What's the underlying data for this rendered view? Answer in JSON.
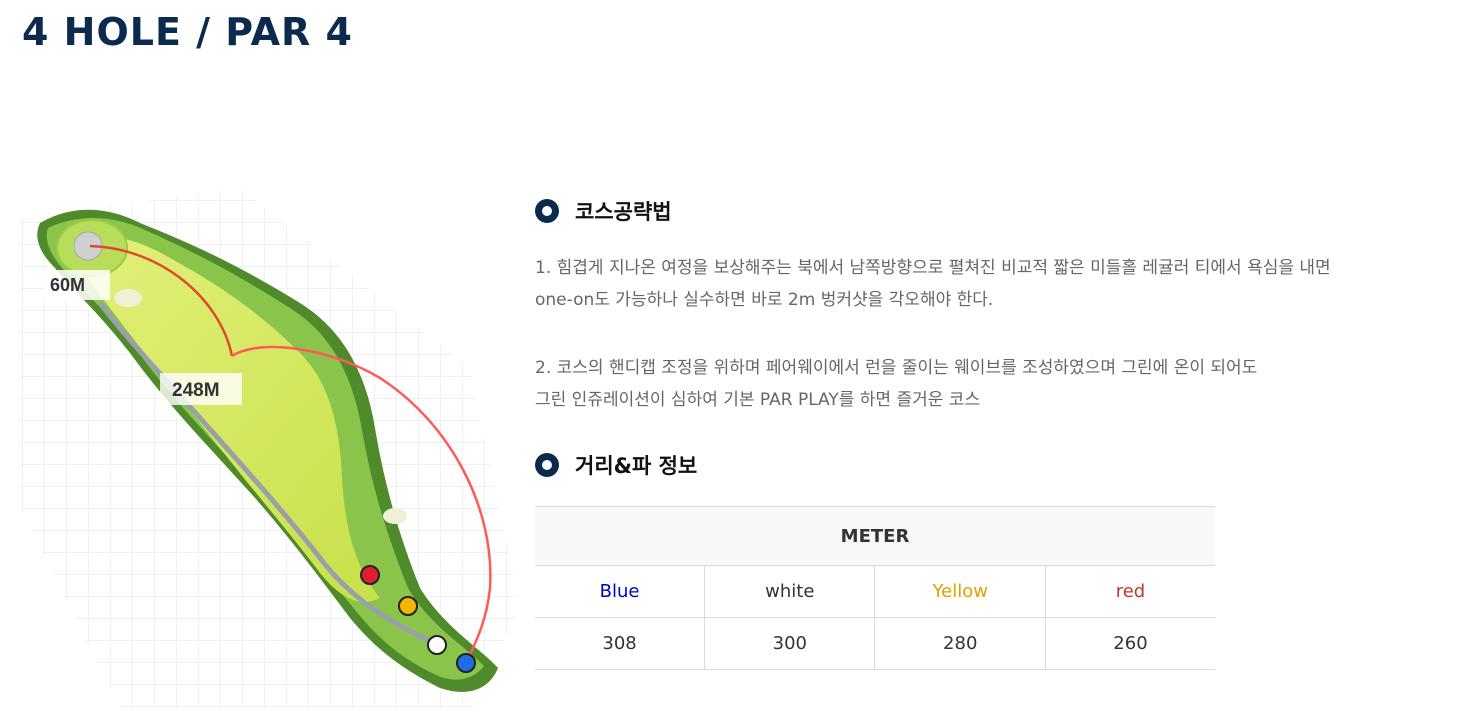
{
  "header": {
    "title": "4 HOLE / PAR 4"
  },
  "course_map": {
    "labels": {
      "green_distance": "60M",
      "fairway_distance": "248M"
    },
    "tee_markers": [
      {
        "name": "red",
        "color": "#e01e2e"
      },
      {
        "name": "yellow",
        "color": "#f2b500"
      },
      {
        "name": "white",
        "color": "#ffffff"
      },
      {
        "name": "blue",
        "color": "#1e6ee0"
      }
    ]
  },
  "strategy": {
    "heading": "코스공략법",
    "paragraphs": [
      {
        "line1": "1. 힘겹게 지나온 여정을 보상해주는 북에서 남쪽방향으로 펼쳐진 비교적 짧은 미들홀 레귤러 티에서 욕심을 내면",
        "line2": "one-on도 가능하나 실수하면 바로 2m 벙커샷을 각오해야 한다."
      },
      {
        "line1": "2. 코스의 핸디캡 조정을 위하며 페어웨이에서 런을 줄이는 웨이브를 조성하였으며 그린에 온이 되어도",
        "line2": "그린 인쥬레이션이 심하여 기본 PAR PLAY를 하면 즐거운 코스"
      }
    ]
  },
  "distance_info": {
    "heading": "거리&파 정보",
    "table": {
      "unit_header": "METER",
      "columns": [
        {
          "label": "Blue",
          "color": "#0000cc",
          "value": "308"
        },
        {
          "label": "white",
          "color": "#333333",
          "value": "300"
        },
        {
          "label": "Yellow",
          "color": "#e0a000",
          "value": "280"
        },
        {
          "label": "red",
          "color": "#c0392b",
          "value": "260"
        }
      ]
    }
  }
}
